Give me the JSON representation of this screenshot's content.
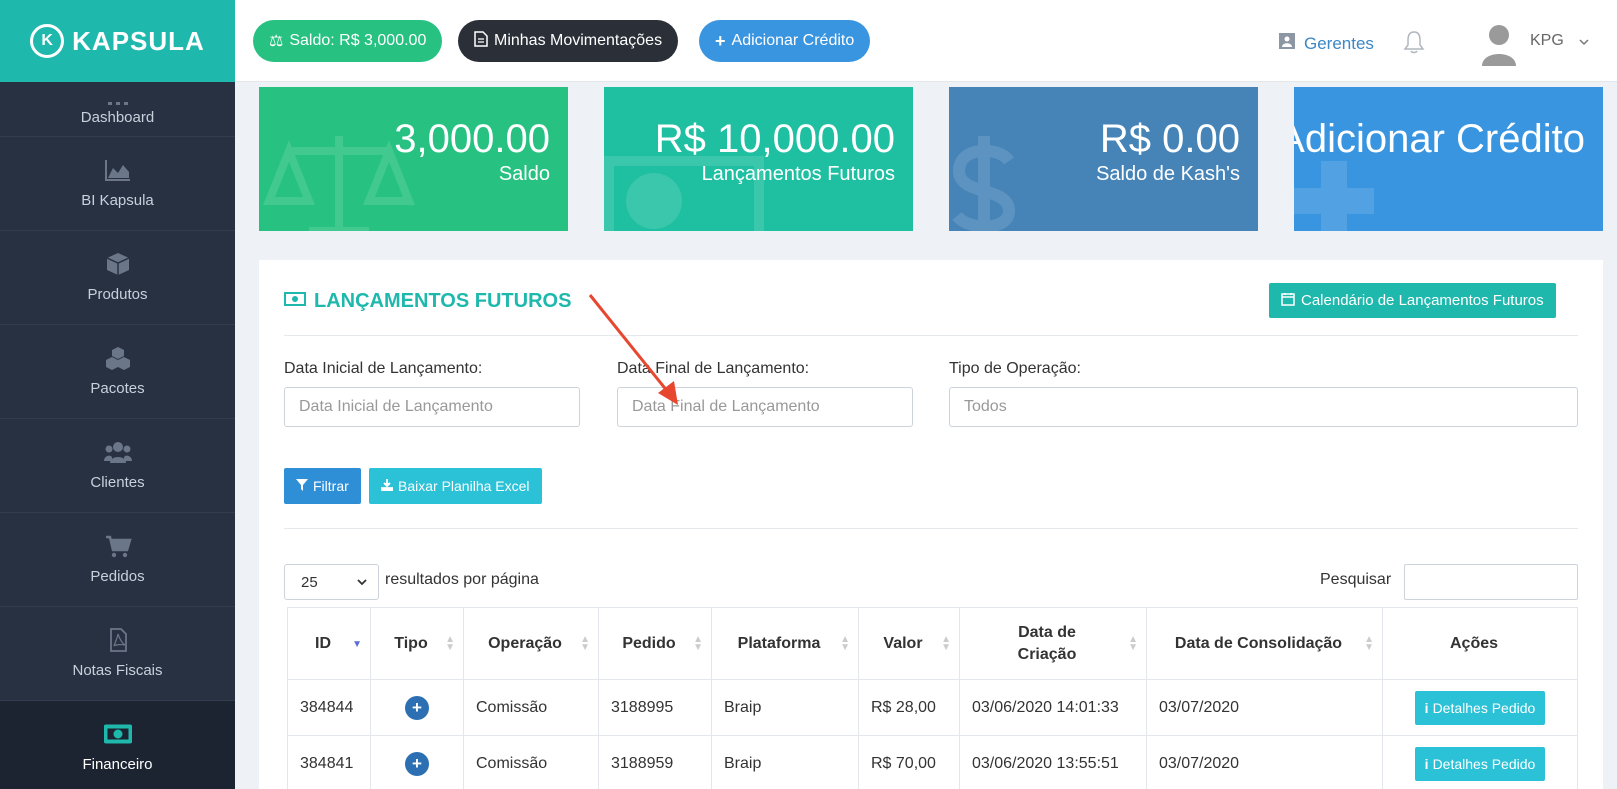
{
  "brand": {
    "name": "KAPSULA",
    "mark": "K"
  },
  "sidebar": {
    "items": [
      {
        "label": "Dashboard",
        "icon": "dashboard-icon"
      },
      {
        "label": "BI Kapsula",
        "icon": "area-chart-icon"
      },
      {
        "label": "Produtos",
        "icon": "cube-icon"
      },
      {
        "label": "Pacotes",
        "icon": "cubes-icon"
      },
      {
        "label": "Clientes",
        "icon": "users-icon"
      },
      {
        "label": "Pedidos",
        "icon": "cart-icon"
      },
      {
        "label": "Notas Fiscais",
        "icon": "pdf-file-icon"
      },
      {
        "label": "Financeiro",
        "icon": "money-icon",
        "active": true
      }
    ]
  },
  "topbar": {
    "saldo": "Saldo: R$ 3,000.00",
    "movimentacoes": "Minhas Movimentações",
    "adicionar": "Adicionar Crédito",
    "gerentes": "Gerentes",
    "user": "KPG"
  },
  "cards": [
    {
      "value": "3,000.00",
      "label": "Saldo",
      "color": "#27c281"
    },
    {
      "value": "R$ 10,000.00",
      "label": "Lançamentos Futuros",
      "color": "#1fbfa1"
    },
    {
      "value": "R$ 0.00",
      "label": "Saldo de Kash's",
      "color": "#4684b8"
    },
    {
      "value": "Adicionar Crédito",
      "label": "",
      "color": "#3a95e0"
    }
  ],
  "panel": {
    "title": "LANÇAMENTOS FUTUROS",
    "calendar_button": "Calendário de Lançamentos Futuros",
    "filters": {
      "start_label": "Data Inicial de Lançamento:",
      "start_placeholder": "Data Inicial de Lançamento",
      "end_label": "Data Final de Lançamento:",
      "end_placeholder": "Data Final de Lançamento",
      "type_label": "Tipo de Operação:",
      "type_value": "Todos"
    },
    "filter_button": "Filtrar",
    "excel_button": "Baixar Planilha Excel",
    "page_size": "25",
    "per_page_label": "resultados por página",
    "search_label": "Pesquisar"
  },
  "table": {
    "headers": [
      "ID",
      "Tipo",
      "Operação",
      "Pedido",
      "Plataforma",
      "Valor",
      "Data de Criação",
      "Data de Consolidação",
      "Ações"
    ],
    "rows": [
      {
        "id": "384844",
        "tipo": "+",
        "operacao": "Comissão",
        "pedido": "3188995",
        "plataforma": "Braip",
        "valor": "R$ 28,00",
        "criacao": "03/06/2020 14:01:33",
        "consolidacao": "03/07/2020",
        "acao": "Detalhes Pedido"
      },
      {
        "id": "384841",
        "tipo": "+",
        "operacao": "Comissão",
        "pedido": "3188959",
        "plataforma": "Braip",
        "valor": "R$ 70,00",
        "criacao": "03/06/2020 13:55:51",
        "consolidacao": "03/07/2020",
        "acao": "Detalhes Pedido"
      }
    ]
  },
  "colors": {
    "accent": "#1fb8ad",
    "sidebar": "#273142",
    "primary": "#3a95e0",
    "annotation": "#e8472f"
  }
}
